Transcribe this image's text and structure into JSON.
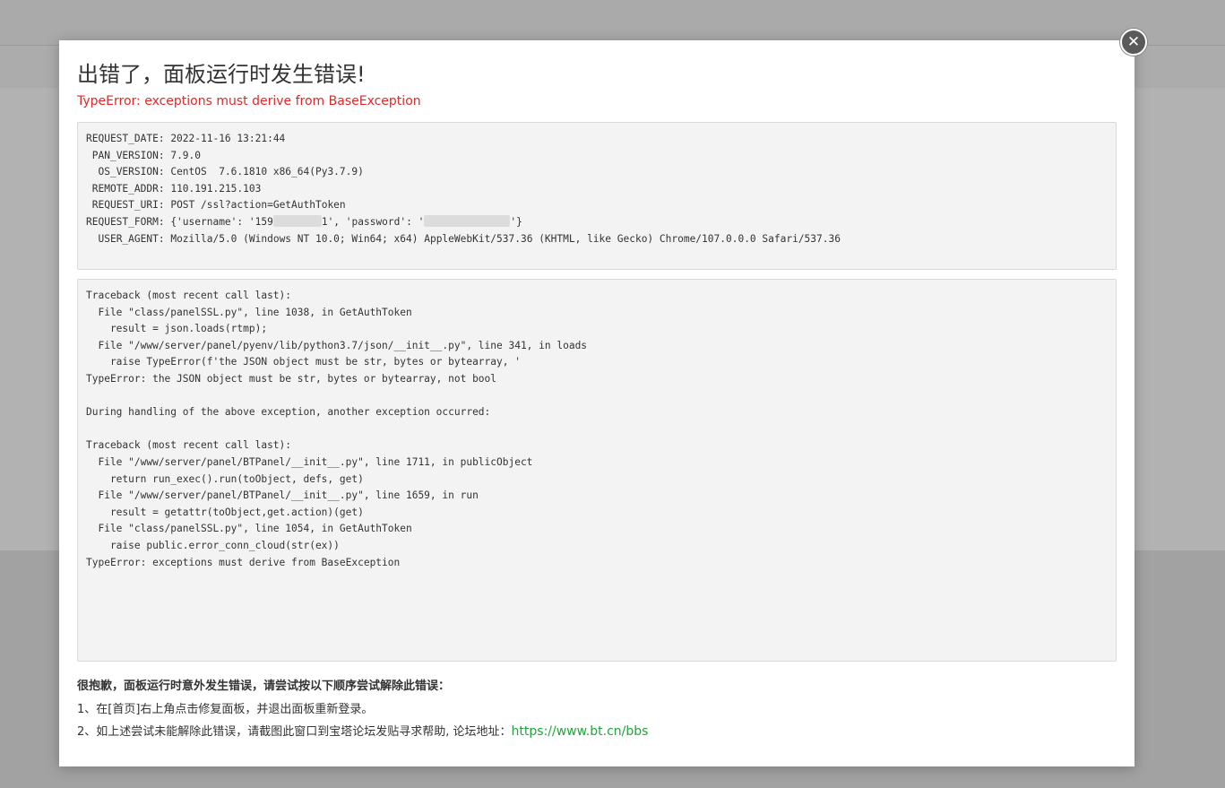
{
  "dialog": {
    "title": "出错了，面板运行时发生错误!",
    "error_summary": "TypeError: exceptions must derive from BaseException",
    "close_glyph": "✕"
  },
  "request_info": {
    "request_date_label": "REQUEST_DATE:",
    "request_date": "2022-11-16 13:21:44",
    "pan_version_label": "PAN_VERSION:",
    "pan_version": "7.9.0",
    "os_version_label": "OS_VERSION:",
    "os_version": "CentOS  7.6.1810 x86_64(Py3.7.9)",
    "remote_addr_label": "REMOTE_ADDR:",
    "remote_addr": "110.191.215.103",
    "request_uri_label": "REQUEST_URI:",
    "request_uri": "POST /ssl?action=GetAuthToken",
    "request_form_label": "REQUEST_FORM:",
    "request_form_part1": "{'username': '159",
    "request_form_part2": "1', 'password': '",
    "request_form_part3": "'}",
    "user_agent_label": "USER_AGENT:",
    "user_agent": "Mozilla/5.0 (Windows NT 10.0; Win64; x64) AppleWebKit/537.36 (KHTML, like Gecko) Chrome/107.0.0.0 Safari/537.36"
  },
  "traceback": [
    "Traceback (most recent call last):",
    "  File \"class/panelSSL.py\", line 1038, in GetAuthToken",
    "    result = json.loads(rtmp);",
    "  File \"/www/server/panel/pyenv/lib/python3.7/json/__init__.py\", line 341, in loads",
    "    raise TypeError(f'the JSON object must be str, bytes or bytearray, '",
    "TypeError: the JSON object must be str, bytes or bytearray, not bool",
    "",
    "During handling of the above exception, another exception occurred:",
    "",
    "Traceback (most recent call last):",
    "  File \"/www/server/panel/BTPanel/__init__.py\", line 1711, in publicObject",
    "    return run_exec().run(toObject, defs, get)",
    "  File \"/www/server/panel/BTPanel/__init__.py\", line 1659, in run",
    "    result = getattr(toObject,get.action)(get)",
    "  File \"class/panelSSL.py\", line 1054, in GetAuthToken",
    "    raise public.error_conn_cloud(str(ex))",
    "TypeError: exceptions must derive from BaseException"
  ],
  "help": {
    "heading": "很抱歉，面板运行时意外发生错误，请尝试按以下顺序尝试解除此错误：",
    "step1": "1、在[首页]右上角点击修复面板，并退出面板重新登录。",
    "step2": "2、如上述尝试未能解除此错误，请截图此窗口到宝塔论坛发贴寻求帮助, 论坛地址：",
    "forum_link": "https://www.bt.cn/bbs"
  }
}
